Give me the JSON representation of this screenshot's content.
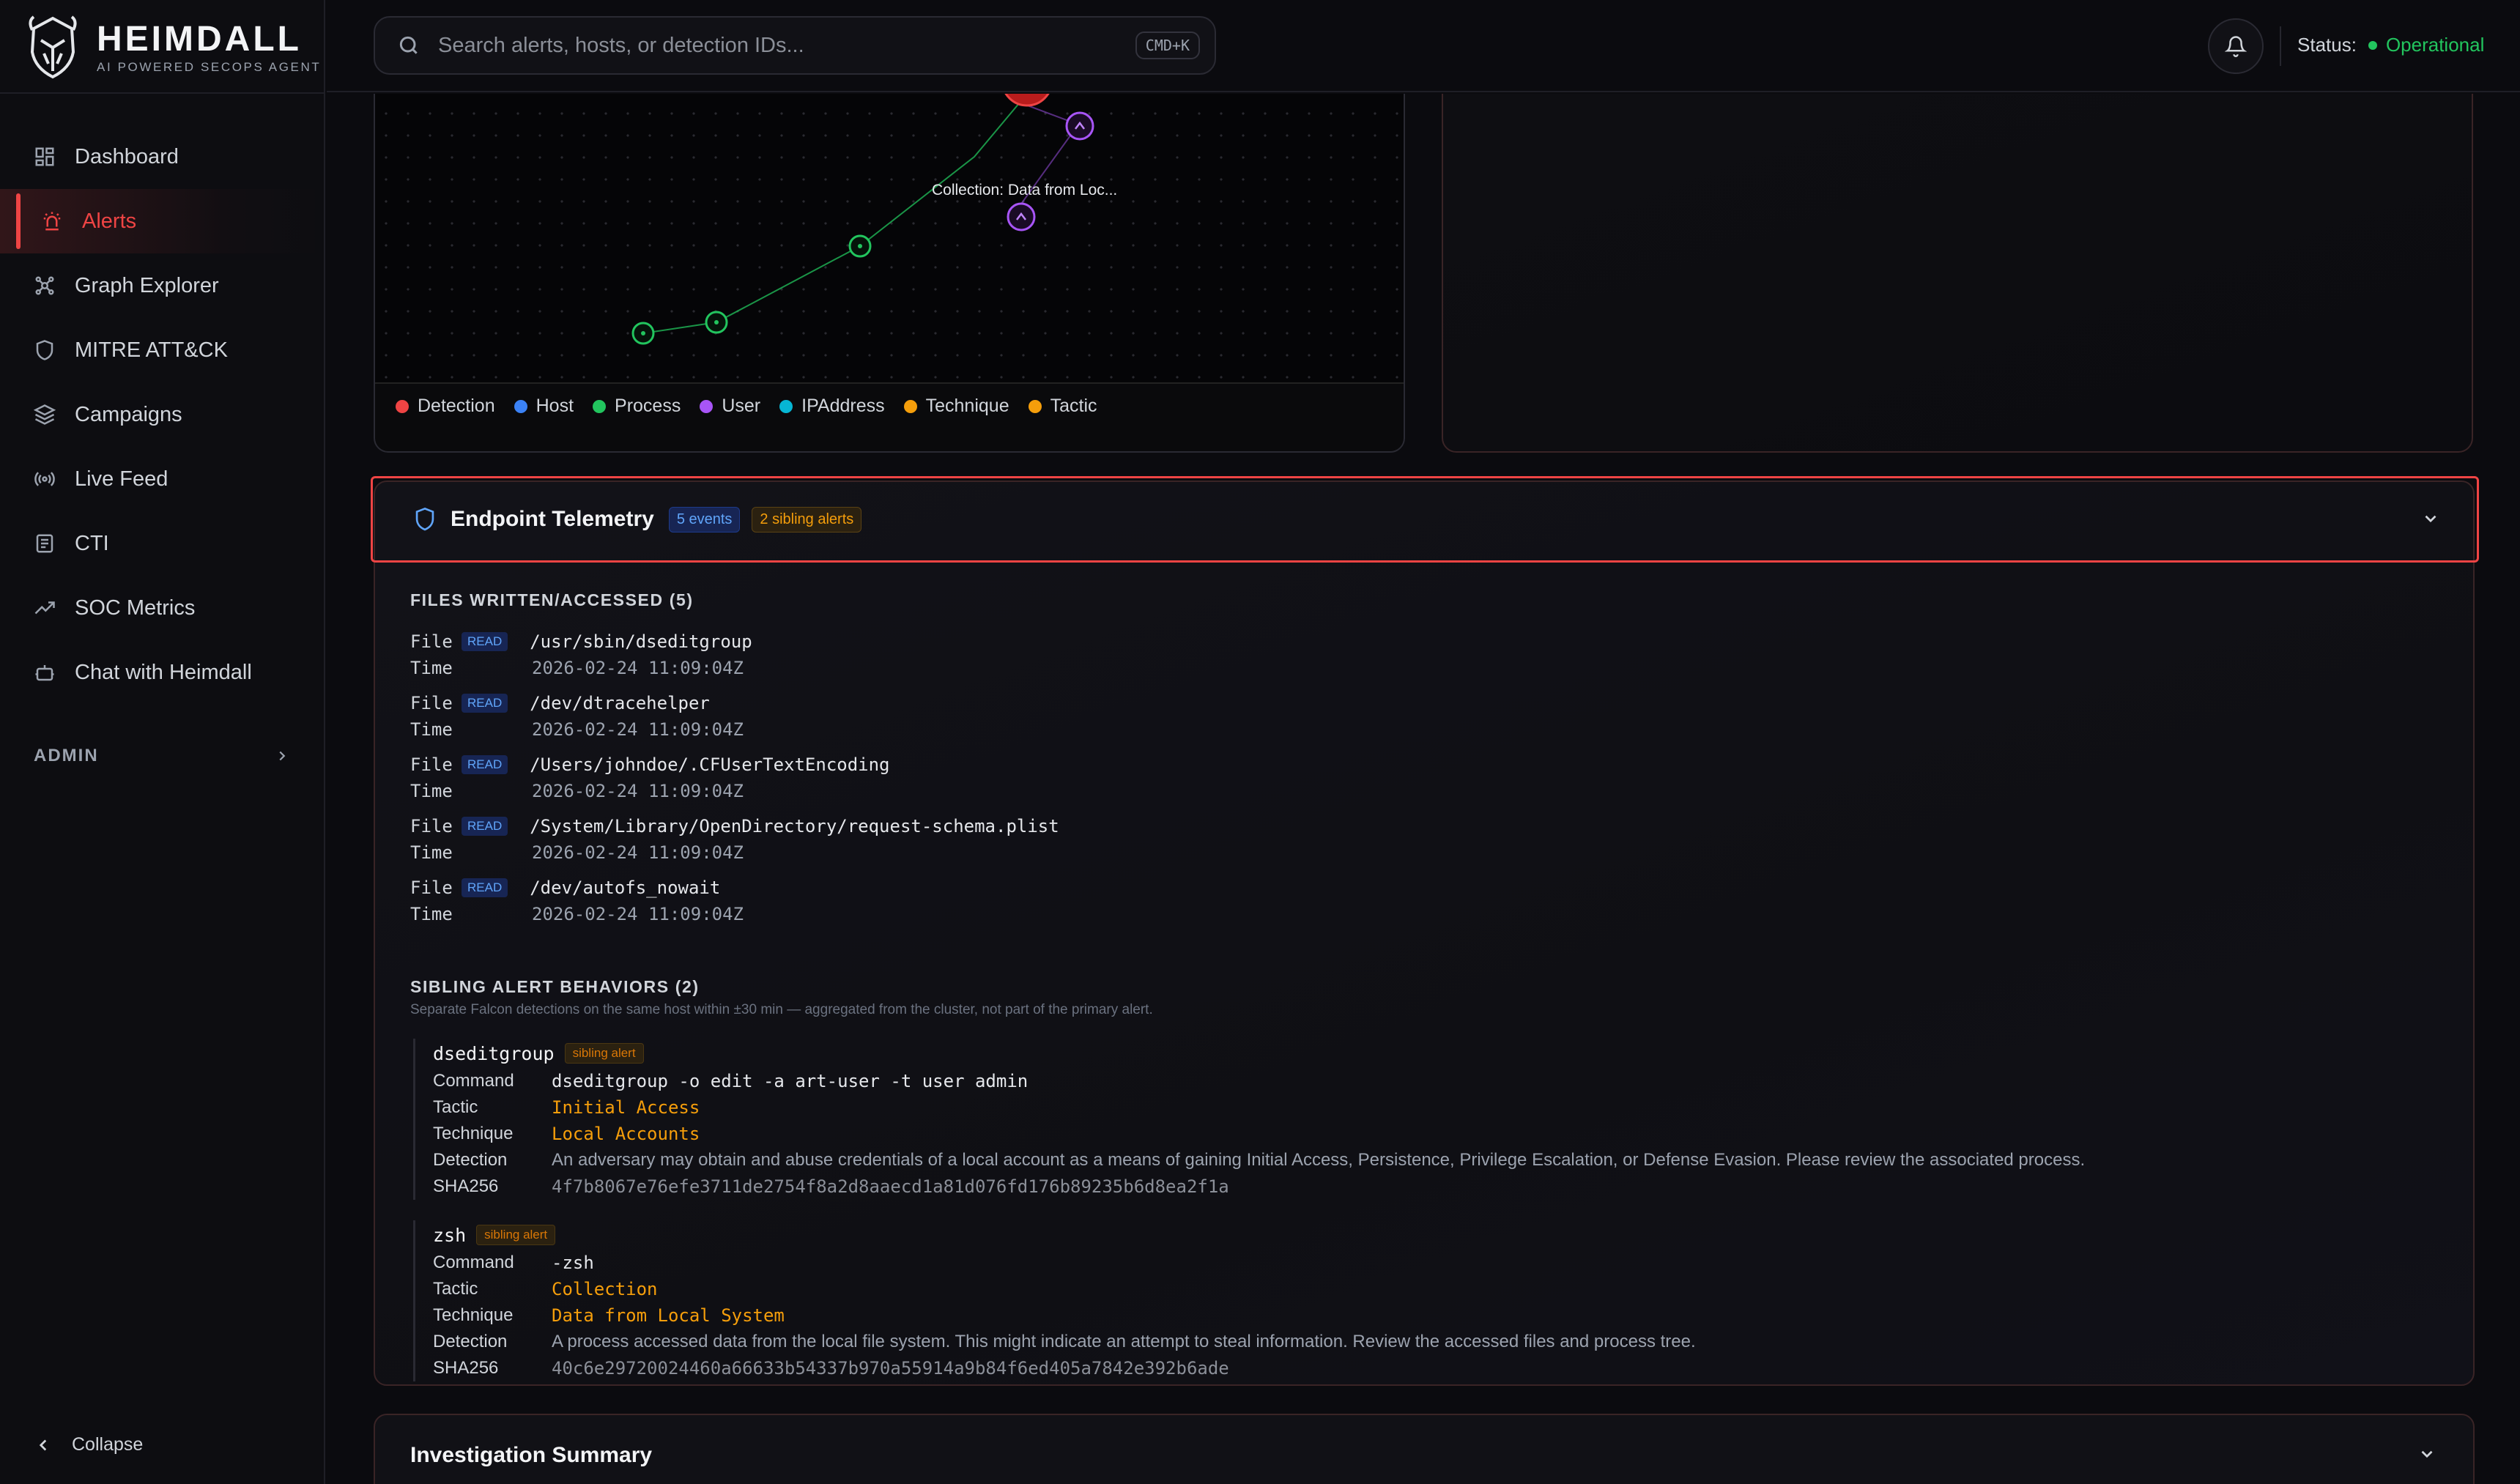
{
  "brand": {
    "name": "HEIMDALL",
    "subtitle": "AI POWERED SECOPS AGENT"
  },
  "sidebar": {
    "items": [
      {
        "label": "Dashboard",
        "icon": "dashboard-icon"
      },
      {
        "label": "Alerts",
        "icon": "siren-icon",
        "active": true
      },
      {
        "label": "Graph Explorer",
        "icon": "graph-icon"
      },
      {
        "label": "MITRE ATT&CK",
        "icon": "shield-icon"
      },
      {
        "label": "Campaigns",
        "icon": "layers-icon"
      },
      {
        "label": "Live Feed",
        "icon": "radio-icon"
      },
      {
        "label": "CTI",
        "icon": "document-icon"
      },
      {
        "label": "SOC Metrics",
        "icon": "trending-up-icon"
      },
      {
        "label": "Chat with Heimdall",
        "icon": "bot-icon"
      }
    ],
    "admin_label": "ADMIN",
    "collapse_label": "Collapse"
  },
  "search": {
    "placeholder": "Search alerts, hosts, or detection IDs...",
    "shortcut": "CMD+K"
  },
  "status": {
    "label": "Status:",
    "value": "Operational",
    "color": "#22c55e"
  },
  "graph": {
    "node_label": "Collection: Data from Loc...",
    "legend": [
      {
        "label": "Detection",
        "color": "#ef4444"
      },
      {
        "label": "Host",
        "color": "#3b82f6"
      },
      {
        "label": "Process",
        "color": "#22c55e"
      },
      {
        "label": "User",
        "color": "#a855f7"
      },
      {
        "label": "IPAddress",
        "color": "#06b6d4"
      },
      {
        "label": "Technique",
        "color": "#f59e0b"
      },
      {
        "label": "Tactic",
        "color": "#f59e0b"
      }
    ]
  },
  "telemetry": {
    "title": "Endpoint Telemetry",
    "events_badge": "5 events",
    "sibling_badge": "2 sibling alerts",
    "files_title": "FILES WRITTEN/ACCESSED (5)",
    "file_label": "File",
    "time_label": "Time",
    "files": [
      {
        "mode": "READ",
        "path": "/usr/sbin/dseditgroup",
        "time": "2026-02-24 11:09:04Z"
      },
      {
        "mode": "READ",
        "path": "/dev/dtracehelper",
        "time": "2026-02-24 11:09:04Z"
      },
      {
        "mode": "READ",
        "path": "/Users/johndoe/.CFUserTextEncoding",
        "time": "2026-02-24 11:09:04Z"
      },
      {
        "mode": "READ",
        "path": "/System/Library/OpenDirectory/request-schema.plist",
        "time": "2026-02-24 11:09:04Z"
      },
      {
        "mode": "READ",
        "path": "/dev/autofs_nowait",
        "time": "2026-02-24 11:09:04Z"
      }
    ],
    "sibling_title": "SIBLING ALERT BEHAVIORS (2)",
    "sibling_subtitle": "Separate Falcon detections on the same host within ±30 min — aggregated from the cluster, not part of the primary alert.",
    "labels": {
      "command": "Command",
      "tactic": "Tactic",
      "technique": "Technique",
      "detection": "Detection",
      "sha": "SHA256",
      "sibling": "sibling alert"
    },
    "siblings": [
      {
        "name": "dseditgroup",
        "command": "dseditgroup -o edit -a art-user -t user admin",
        "tactic": "Initial Access",
        "technique": "Local Accounts",
        "detection": "An adversary may obtain and abuse credentials of a local account as a means of gaining Initial Access, Persistence, Privilege Escalation, or Defense Evasion. Please review the associated process.",
        "sha256": "4f7b8067e76efe3711de2754f8a2d8aaecd1a81d076fd176b89235b6d8ea2f1a"
      },
      {
        "name": "zsh",
        "command": "-zsh",
        "tactic": "Collection",
        "technique": "Data from Local System",
        "detection": "A process accessed data from the local file system. This might indicate an attempt to steal information. Review the accessed files and process tree.",
        "sha256": "40c6e29720024460a66633b54337b970a55914a9b84f6ed405a7842e392b6ade"
      }
    ]
  },
  "investigation": {
    "title": "Investigation Summary"
  }
}
